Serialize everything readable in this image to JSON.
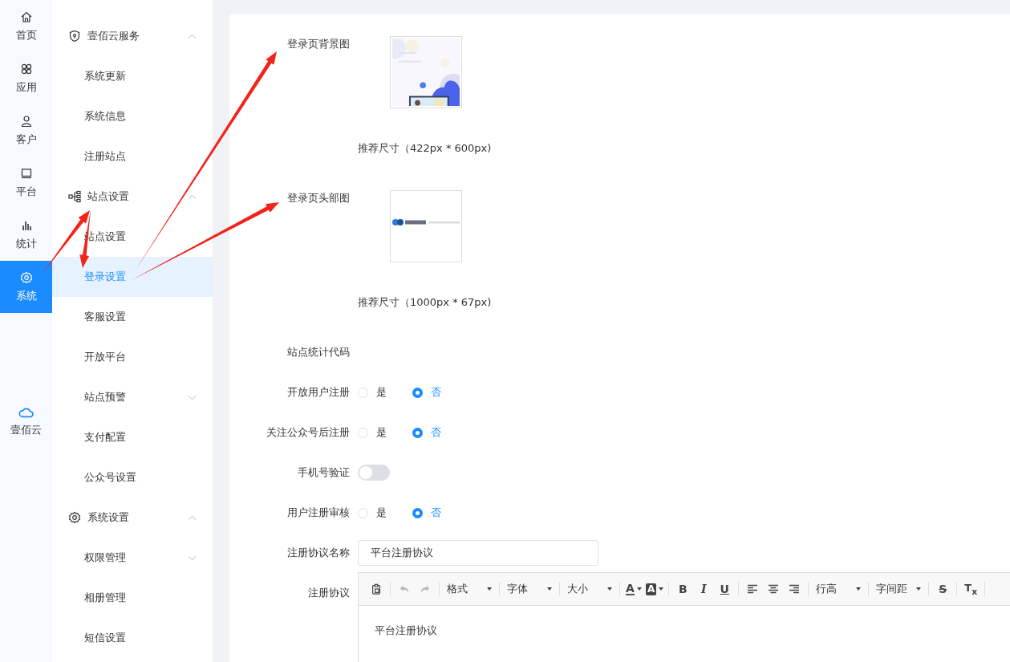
{
  "rail": [
    {
      "label": "首页",
      "kind": "home",
      "selected": false
    },
    {
      "label": "应用",
      "kind": "apps",
      "selected": false
    },
    {
      "label": "客户",
      "kind": "user",
      "selected": false
    },
    {
      "label": "平台",
      "kind": "monitor",
      "selected": false
    },
    {
      "label": "统计",
      "kind": "stats",
      "selected": false
    },
    {
      "label": "系统",
      "kind": "gear",
      "selected": true
    }
  ],
  "rail_bottom": {
    "label": "壹佰云",
    "kind": "cloud"
  },
  "menu": [
    {
      "label": "壹佰云服务",
      "kind": "shield",
      "expanded": true,
      "children": [
        {
          "label": "系统更新",
          "selected": false
        },
        {
          "label": "系统信息",
          "selected": false
        },
        {
          "label": "注册站点",
          "selected": false
        }
      ]
    },
    {
      "label": "站点设置",
      "kind": "tree",
      "expanded": true,
      "children": [
        {
          "label": "站点设置",
          "selected": false
        },
        {
          "label": "登录设置",
          "selected": true
        },
        {
          "label": "客服设置",
          "selected": false
        },
        {
          "label": "开放平台",
          "selected": false
        },
        {
          "label": "站点预警",
          "selected": false,
          "expanded": false
        },
        {
          "label": "支付配置",
          "selected": false
        },
        {
          "label": "公众号设置",
          "selected": false
        }
      ]
    },
    {
      "label": "系统设置",
      "kind": "gear",
      "expanded": true,
      "children": [
        {
          "label": "权限管理",
          "selected": false,
          "expanded": false
        },
        {
          "label": "相册管理",
          "selected": false
        },
        {
          "label": "短信设置",
          "selected": false
        }
      ]
    }
  ],
  "form": [
    {
      "label": "登录页背景图",
      "hint": "推荐尺寸（422px * 600px)"
    },
    {
      "label": "登录页头部图",
      "hint": "推荐尺寸（1000px * 67px)"
    },
    {
      "kind": "empty",
      "label": "站点统计代码"
    },
    {
      "kind": "radio",
      "label": "开放用户注册",
      "options": [
        {
          "label": "是",
          "selected": false
        },
        {
          "label": "否",
          "selected": true
        }
      ]
    },
    {
      "kind": "radio",
      "label": "关注公众号后注册",
      "options": [
        {
          "label": "是",
          "selected": false
        },
        {
          "label": "否",
          "selected": true
        }
      ]
    },
    {
      "kind": "switch",
      "label": "手机号验证",
      "on": false
    },
    {
      "kind": "radio",
      "label": "用户注册审核",
      "options": [
        {
          "label": "是",
          "selected": false
        },
        {
          "label": "否",
          "selected": true
        }
      ]
    },
    {
      "kind": "input",
      "label": "注册协议名称",
      "value": "平台注册协议"
    },
    {
      "kind": "editor",
      "label": "注册协议",
      "content": "平台注册协议",
      "toolbar": [
        {
          "kind": "paste",
          "disabled": false
        },
        {
          "kind": "sep"
        },
        {
          "kind": "undo",
          "disabled": true
        },
        {
          "kind": "redo",
          "disabled": true
        },
        {
          "kind": "sep"
        },
        {
          "kind": "select",
          "label": "格式"
        },
        {
          "kind": "sep"
        },
        {
          "kind": "select",
          "label": "字体"
        },
        {
          "kind": "sep"
        },
        {
          "kind": "select",
          "label": "大小"
        },
        {
          "kind": "sep"
        },
        {
          "kind": "fore",
          "label": "A"
        },
        {
          "kind": "back",
          "label": "A"
        },
        {
          "kind": "sep"
        },
        {
          "kind": "bold",
          "label": "B"
        },
        {
          "kind": "italic",
          "label": "I"
        },
        {
          "kind": "underline",
          "label": "U"
        },
        {
          "kind": "sep"
        },
        {
          "kind": "align-left"
        },
        {
          "kind": "align-center"
        },
        {
          "kind": "align-right"
        },
        {
          "kind": "sep"
        },
        {
          "kind": "select",
          "label": "行高"
        },
        {
          "kind": "sep"
        },
        {
          "kind": "select",
          "label": "字间距"
        },
        {
          "kind": "sep"
        },
        {
          "kind": "strike",
          "label": "S"
        },
        {
          "kind": "sep"
        },
        {
          "kind": "clear",
          "label": "T$_{x}$"
        },
        {
          "kind": "sep"
        }
      ]
    }
  ]
}
